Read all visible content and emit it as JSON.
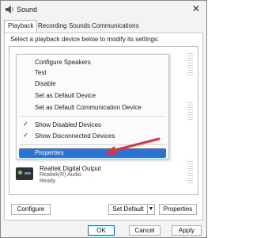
{
  "window": {
    "title": "Sound",
    "close_glyph": "✕"
  },
  "tabs": [
    {
      "label": "Playback"
    },
    {
      "label": "Recording"
    },
    {
      "label": "Sounds"
    },
    {
      "label": "Communications"
    }
  ],
  "instruction": "Select a playback device below to modify its settings:",
  "device": {
    "name": "Realtek Digital Output",
    "sub": "Realtek(R) Audio",
    "status": "Ready"
  },
  "context_menu": {
    "items": [
      {
        "label": "Configure Speakers",
        "checked": false
      },
      {
        "label": "Test",
        "checked": false
      },
      {
        "label": "Disable",
        "checked": false
      },
      {
        "label": "Set as Default Device",
        "checked": false
      },
      {
        "label": "Set as Default Communication Device",
        "checked": false
      },
      {
        "label": "Show Disabled Devices",
        "checked": true
      },
      {
        "label": "Show Disconnected Devices",
        "checked": true
      },
      {
        "label": "Properties",
        "checked": false,
        "highlighted": true
      }
    ],
    "check_glyph": "✓"
  },
  "panel_buttons": {
    "configure": "Configure",
    "set_default": "Set Default",
    "set_default_arrow": "▼",
    "properties": "Properties"
  },
  "dialog_buttons": {
    "ok": "OK",
    "cancel": "Cancel",
    "apply": "Apply"
  },
  "colors": {
    "accent": "#2b73d6",
    "annotation_arrow": "#e0353a"
  }
}
